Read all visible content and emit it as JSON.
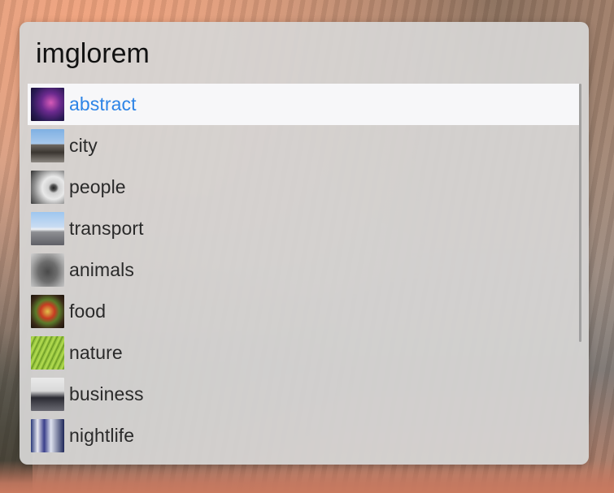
{
  "search": {
    "query": "imglorem"
  },
  "results": [
    {
      "label": "abstract",
      "thumb_icon": "abstract-thumbnail",
      "selected": true
    },
    {
      "label": "city",
      "thumb_icon": "city-thumbnail",
      "selected": false
    },
    {
      "label": "people",
      "thumb_icon": "people-thumbnail",
      "selected": false
    },
    {
      "label": "transport",
      "thumb_icon": "transport-thumbnail",
      "selected": false
    },
    {
      "label": "animals",
      "thumb_icon": "animals-thumbnail",
      "selected": false
    },
    {
      "label": "food",
      "thumb_icon": "food-thumbnail",
      "selected": false
    },
    {
      "label": "nature",
      "thumb_icon": "nature-thumbnail",
      "selected": false
    },
    {
      "label": "business",
      "thumb_icon": "business-thumbnail",
      "selected": false
    },
    {
      "label": "nightlife",
      "thumb_icon": "nightlife-thumbnail",
      "selected": false
    }
  ],
  "colors": {
    "selected_text": "#2d84e6",
    "selected_row_bg": "#f7f7f9",
    "panel_bg": "#d6d4d3",
    "text": "#2a2a2a"
  }
}
